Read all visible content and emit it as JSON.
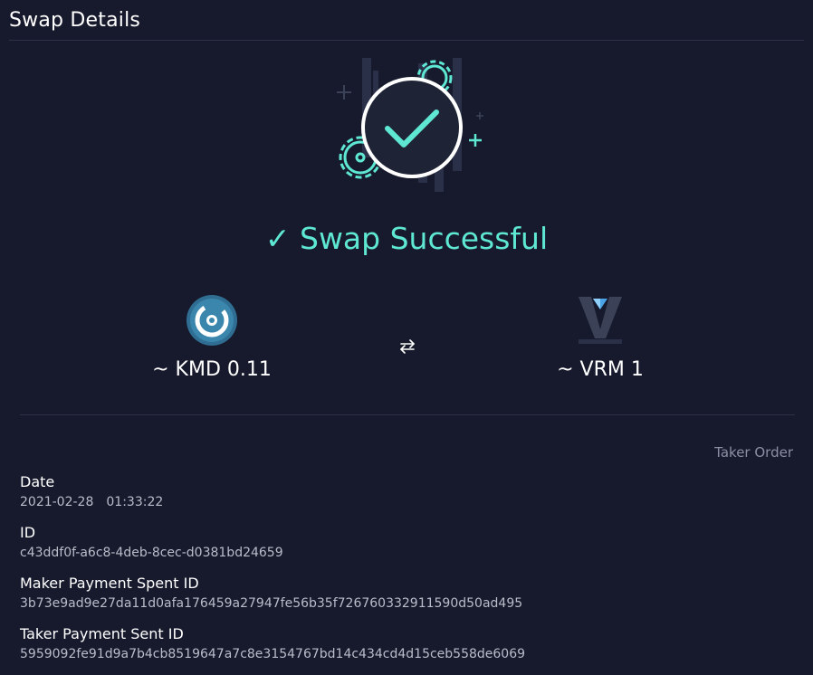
{
  "header": {
    "title": "Swap Details"
  },
  "status": {
    "text": "✓ Swap Successful",
    "color": "#5ee8d3"
  },
  "swap": {
    "base": {
      "amount": "~ KMD 0.11",
      "icon": "kmd-coin-icon"
    },
    "rel": {
      "amount": "~ VRM 1",
      "icon": "vrm-coin-icon"
    },
    "direction_icon": "swap-arrows-icon"
  },
  "order": {
    "type": "Taker Order"
  },
  "details": {
    "date": {
      "label": "Date",
      "date": "2021-02-28",
      "time": "01:33:22"
    },
    "id": {
      "label": "ID",
      "value": "c43ddf0f-a6c8-4deb-8cec-d0381bd24659"
    },
    "maker_payment": {
      "label": "Maker Payment Spent ID",
      "value": "3b73e9ad9e27da11d0afa176459a27947fe56b35f726760332911590d50ad495"
    },
    "taker_payment": {
      "label": "Taker Payment Sent ID",
      "value": "5959092fe91d9a7b4cb8519647a7c8e3154767bd14c434cd4d15ceb558de6069"
    }
  },
  "colors": {
    "background": "#171a2c",
    "accent": "#5ee8d3",
    "muted": "#8a8fa3"
  }
}
